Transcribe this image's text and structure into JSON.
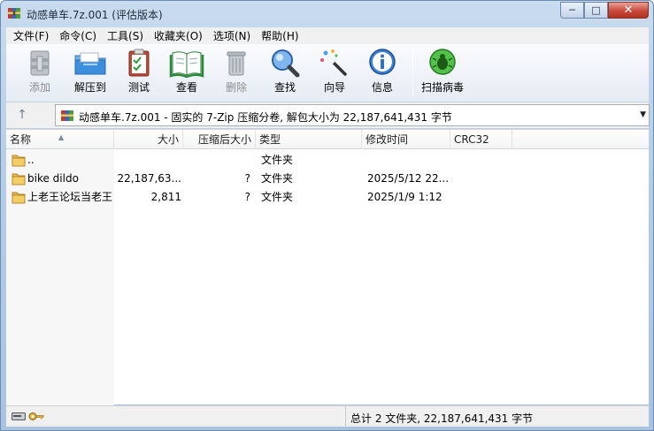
{
  "window": {
    "title": "动感单车.7z.001 (评估版本)",
    "controls": {
      "minimize": "─",
      "maximize": "□",
      "close": "✕"
    }
  },
  "menu": [
    "文件(F)",
    "命令(C)",
    "工具(S)",
    "收藏夹(O)",
    "选项(N)",
    "帮助(H)"
  ],
  "toolbar": {
    "add": "添加",
    "extract": "解压到",
    "test": "测试",
    "view": "查看",
    "delete": "删除",
    "find": "查找",
    "wizard": "向导",
    "info": "信息",
    "scan": "扫描病毒"
  },
  "address": {
    "text": "动感单车.7z.001 - 固实的 7-Zip 压缩分卷, 解包大小为 22,187,641,431 字节"
  },
  "columns": {
    "name": "名称",
    "size": "大小",
    "packed": "压缩后大小",
    "type": "类型",
    "modified": "修改时间",
    "crc": "CRC32"
  },
  "rows": [
    {
      "name": "..",
      "size": "",
      "packed": "",
      "type": "文件夹",
      "modified": ""
    },
    {
      "name": "bike dildo",
      "size": "22,187,63...",
      "packed": "?",
      "type": "文件夹",
      "modified": "2025/5/12 22..."
    },
    {
      "name": "上老王论坛当老王",
      "size": "2,811",
      "packed": "?",
      "type": "文件夹",
      "modified": "2025/1/9 1:12"
    }
  ],
  "status": {
    "summary": "总计 2 文件夹, 22,187,641,431 字节"
  }
}
